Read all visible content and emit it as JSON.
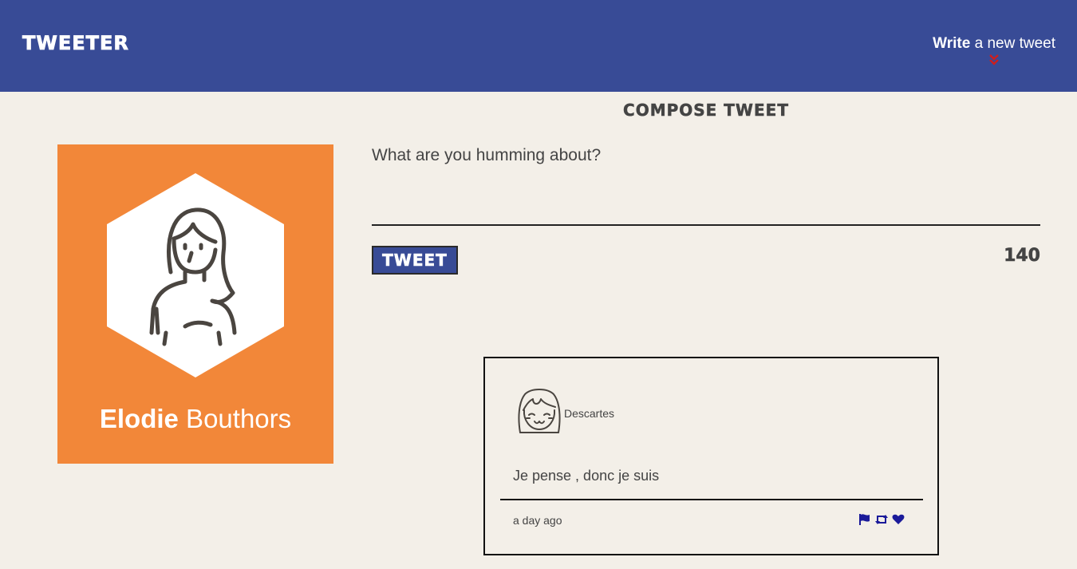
{
  "header": {
    "brand": "TWEETER",
    "compose_bold": "Write",
    "compose_rest": " a new tweet",
    "compose_icon": "double-chevron-down-icon",
    "bg_color": "#384b96",
    "chevron_color": "#cc1f1f"
  },
  "profile": {
    "first_name": "Elodie",
    "last_name": " Bouthors",
    "avatar_icon": "woman-avatar-icon",
    "bg_color": "#f28739"
  },
  "compose": {
    "title": "COMPOSE TWEET",
    "placeholder": "What are you humming about?",
    "button_label": "TWEET",
    "counter": "140"
  },
  "tweets": [
    {
      "author": "Descartes",
      "avatar_icon": "smiling-girl-avatar-icon",
      "text": "Je pense , donc je suis",
      "time": "a day ago",
      "actions": [
        "flag-icon",
        "retweet-icon",
        "heart-icon"
      ],
      "action_color": "#1b1b9a"
    }
  ]
}
